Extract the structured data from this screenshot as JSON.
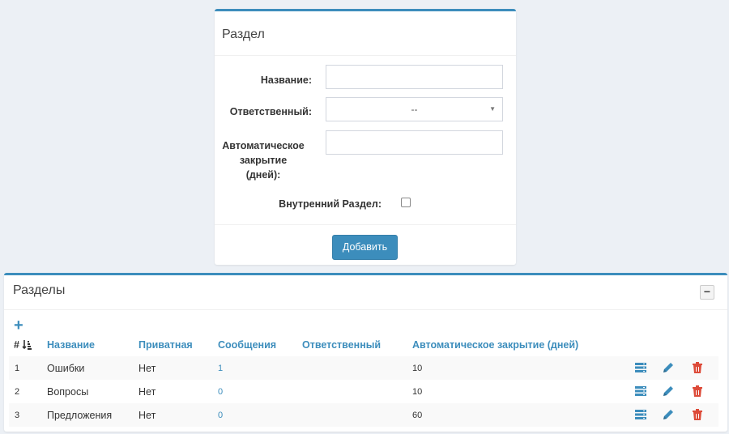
{
  "form": {
    "title": "Раздел",
    "name_label": "Название:",
    "name_value": "",
    "responsible_label": "Ответственный:",
    "responsible_value": "--",
    "autoclose_label_line1": "Автоматическое",
    "autoclose_label_line2": "закрытие",
    "autoclose_label_line3": "(дней):",
    "autoclose_value": "",
    "internal_label": "Внутренний Раздел:",
    "internal_checked": false,
    "add_button": "Добавить"
  },
  "list": {
    "title": "Разделы",
    "collapse_label": "−",
    "columns": {
      "hash": "#",
      "name": "Название",
      "private": "Приватная",
      "messages": "Сообщения",
      "responsible": "Ответственный",
      "autoclose": "Автоматическое закрытие (дней)"
    },
    "rows": [
      {
        "num": "1",
        "name": "Ошибки",
        "private": "Нет",
        "messages": "1",
        "responsible": "",
        "autoclose": "10"
      },
      {
        "num": "2",
        "name": "Вопросы",
        "private": "Нет",
        "messages": "0",
        "responsible": "",
        "autoclose": "10"
      },
      {
        "num": "3",
        "name": "Предложения",
        "private": "Нет",
        "messages": "0",
        "responsible": "",
        "autoclose": "60"
      }
    ]
  },
  "colors": {
    "accent": "#3c8dbc",
    "delete": "#dd4b39"
  },
  "icons": {
    "add": "plus-icon",
    "sort": "sort-amount-icon",
    "details": "server-list-icon",
    "edit": "pencil-icon",
    "delete": "trash-icon",
    "collapse": "minus-icon"
  }
}
